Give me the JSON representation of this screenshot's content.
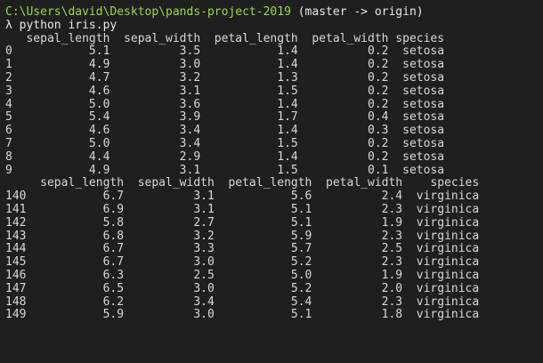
{
  "prompt": {
    "path": "C:\\Users\\david\\Desktop\\pands-project-2019",
    "branch": " (master -> origin)",
    "symbol": "λ",
    "command": " python iris.py"
  },
  "output_lines": [
    "   sepal_length  sepal_width  petal_length  petal_width species",
    "0           5.1          3.5           1.4          0.2  setosa",
    "1           4.9          3.0           1.4          0.2  setosa",
    "2           4.7          3.2           1.3          0.2  setosa",
    "3           4.6          3.1           1.5          0.2  setosa",
    "4           5.0          3.6           1.4          0.2  setosa",
    "5           5.4          3.9           1.7          0.4  setosa",
    "6           4.6          3.4           1.4          0.3  setosa",
    "7           5.0          3.4           1.5          0.2  setosa",
    "8           4.4          2.9           1.4          0.2  setosa",
    "9           4.9          3.1           1.5          0.1  setosa",
    "     sepal_length  sepal_width  petal_length  petal_width    species",
    "140           6.7          3.1           5.6          2.4  virginica",
    "141           6.9          3.1           5.1          2.3  virginica",
    "142           5.8          2.7           5.1          1.9  virginica",
    "143           6.8          3.2           5.9          2.3  virginica",
    "144           6.7          3.3           5.7          2.5  virginica",
    "145           6.7          3.0           5.2          2.3  virginica",
    "146           6.3          2.5           5.0          1.9  virginica",
    "147           6.5          3.0           5.2          2.0  virginica",
    "148           6.2          3.4           5.4          2.3  virginica",
    "149           5.9          3.0           5.1          1.8  virginica"
  ]
}
